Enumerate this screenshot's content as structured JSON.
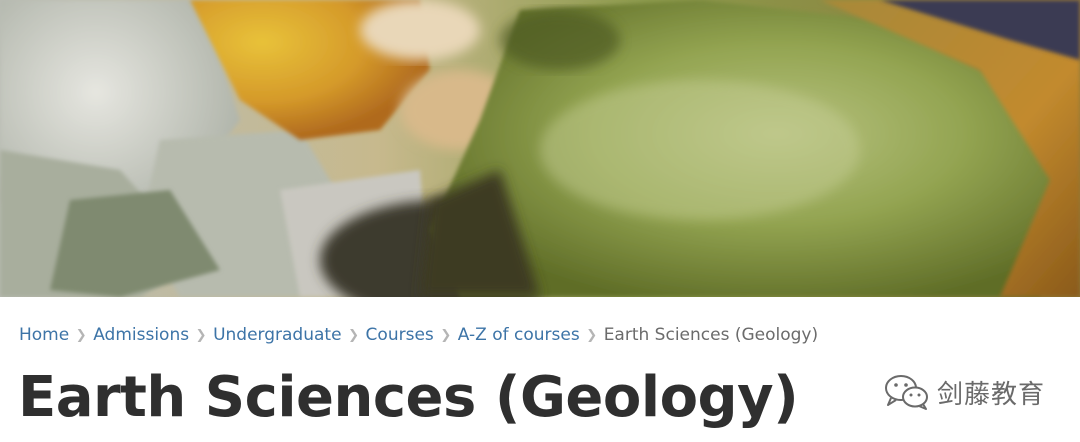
{
  "hero": {
    "image_name": "mineral-crystals-photo"
  },
  "breadcrumb": {
    "items": [
      {
        "label": "Home"
      },
      {
        "label": "Admissions"
      },
      {
        "label": "Undergraduate"
      },
      {
        "label": "Courses"
      },
      {
        "label": "A-Z of courses"
      }
    ],
    "current": "Earth Sciences (Geology)",
    "separator": "❯"
  },
  "page": {
    "title": "Earth Sciences (Geology)"
  },
  "watermark": {
    "icon": "wechat-icon",
    "text": "剑藤教育"
  },
  "colors": {
    "link": "#3d74a7",
    "title": "#2f2f2f",
    "current": "#6b6b6b"
  }
}
